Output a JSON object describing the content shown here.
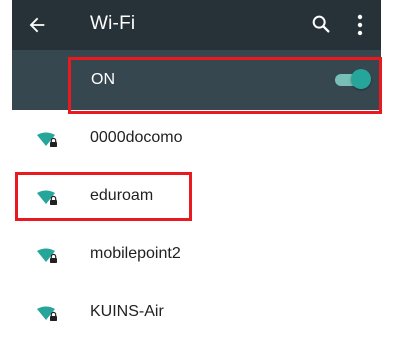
{
  "appbar": {
    "title": "Wi-Fi",
    "back_icon": "arrow-left-icon",
    "search_icon": "search-icon",
    "menu_icon": "more-vert-icon",
    "background": "#263238"
  },
  "master_switch": {
    "label": "ON",
    "state": "on",
    "background": "#37474f",
    "accent": "#26a69a"
  },
  "networks": [
    {
      "ssid": "0000docomo",
      "icon": "wifi-locked-icon"
    },
    {
      "ssid": "eduroam",
      "icon": "wifi-locked-icon"
    },
    {
      "ssid": "mobilepoint2",
      "icon": "wifi-locked-icon"
    },
    {
      "ssid": "KUINS-Air",
      "icon": "wifi-locked-icon"
    }
  ],
  "highlight_color": "#e8191f"
}
